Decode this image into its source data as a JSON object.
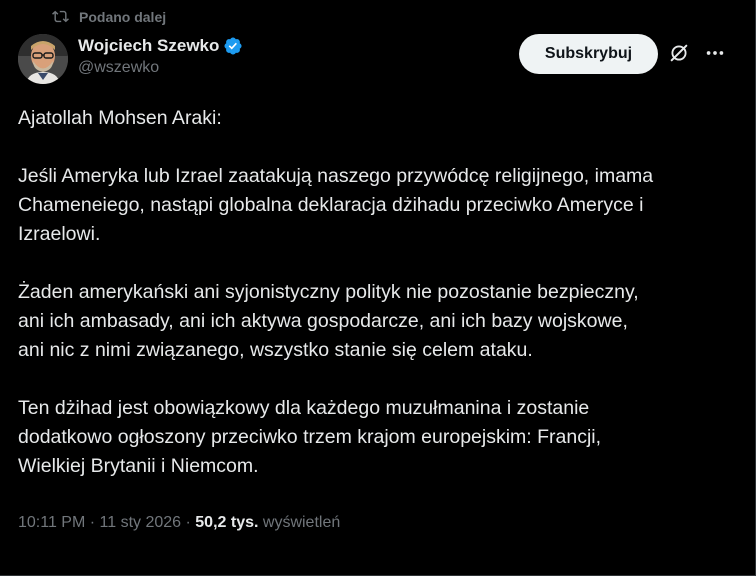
{
  "repost": {
    "label": "Podano dalej",
    "icon": "repost-icon"
  },
  "author": {
    "display_name": "Wojciech Szewko",
    "handle": "@wszewko",
    "verified_icon": "verified-badge-icon",
    "verified_color": "#1d9bf0"
  },
  "actions": {
    "subscribe_label": "Subskrybuj",
    "grok_icon": "grok-icon",
    "more_icon": "more-icon"
  },
  "tweet": {
    "paragraphs": [
      [
        "Ajatollah Mohsen Araki:"
      ],
      [
        "Jeśli Ameryka lub Izrael zaatakują naszego przywódcę religijnego, imama",
        "Chameneiego, nastąpi globalna deklaracja dżihadu przeciwko Ameryce i",
        "Izraelowi."
      ],
      [
        "Żaden amerykański ani syjonistyczny polityk nie pozostanie bezpieczny,",
        "ani ich ambasady, ani ich aktywa gospodarcze, ani ich bazy wojskowe,",
        "ani nic z nimi związanego, wszystko  stanie się celem ataku."
      ],
      [
        "Ten dżihad jest obowiązkowy dla każdego muzułmanina i zostanie",
        "dodatkowo ogłoszony przeciwko trzem krajom europejskim: Francji,",
        "Wielkiej Brytanii i Niemcom."
      ]
    ]
  },
  "meta": {
    "time": "10:11 PM",
    "separator": " · ",
    "date": "11 sty 2026",
    "views_count": "50,2 tys.",
    "views_label": "wyświetleń"
  },
  "colors": {
    "background": "#000000",
    "text": "#e7e9ea",
    "secondary": "#71767b",
    "button_bg": "#eff3f4",
    "button_text": "#0f1419",
    "border": "#2f3336"
  }
}
